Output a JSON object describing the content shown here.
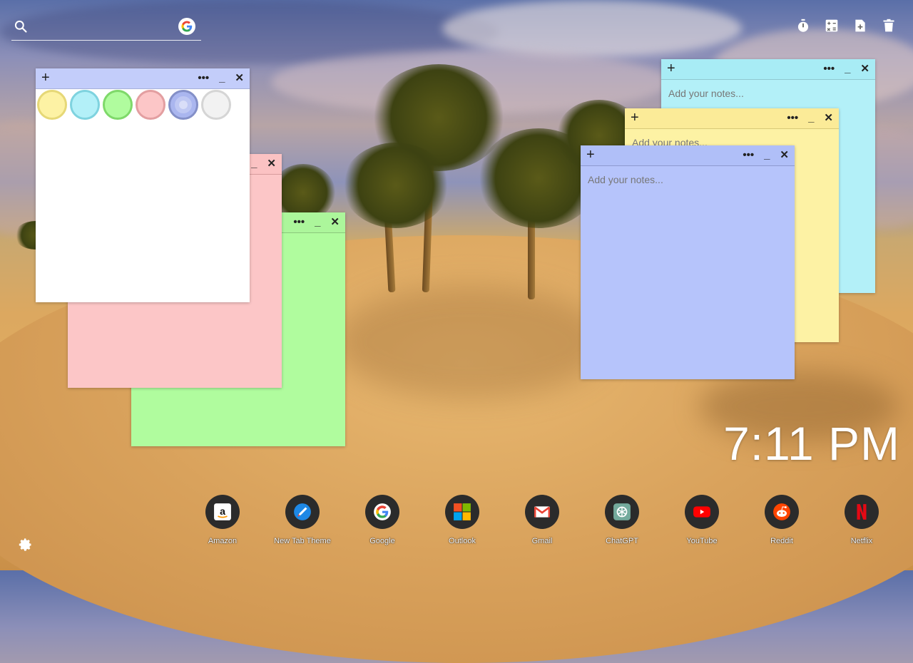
{
  "search": {
    "placeholder": "",
    "engine_icon": "google-g-icon"
  },
  "top_tools": [
    {
      "name": "timer-icon"
    },
    {
      "name": "calculator-icon"
    },
    {
      "name": "new-note-icon"
    },
    {
      "name": "trash-icon"
    }
  ],
  "notes": [
    {
      "color": "#b3f0f8",
      "placeholder": "Add your notes...",
      "plus": "+",
      "more": "•••",
      "minimize": "_",
      "close": "✕"
    },
    {
      "color": "#fdf2a4",
      "placeholder": "Add your notes...",
      "plus": "+",
      "more": "•••",
      "minimize": "_",
      "close": "✕"
    },
    {
      "color": "#b6c4fb",
      "placeholder": "Add your notes...",
      "plus": "+",
      "more": "•••",
      "minimize": "_",
      "close": "✕"
    },
    {
      "color": "#fcc6c7",
      "minimize": "_",
      "close": "✕"
    },
    {
      "color": "#b0fc9e",
      "more": "•••",
      "minimize": "_",
      "close": "✕"
    },
    {
      "color": "#ffffff",
      "plus": "+",
      "more": "•••",
      "minimize": "_",
      "close": "✕"
    }
  ],
  "color_swatches": [
    {
      "name": "yellow",
      "fill": "#fdf2a4",
      "ring": "#e6d877"
    },
    {
      "name": "cyan",
      "fill": "#b3f0f8",
      "ring": "#7fd3df"
    },
    {
      "name": "green",
      "fill": "#b0fc9e",
      "ring": "#7fd96a"
    },
    {
      "name": "pink",
      "fill": "#fcc6c7",
      "ring": "#e39fa1"
    },
    {
      "name": "periwinkle",
      "fill": "#aab6ef",
      "ring": "#8490c8",
      "selected": true
    },
    {
      "name": "white",
      "fill": "#f2f2f2",
      "ring": "#d5d5d5"
    }
  ],
  "clock": {
    "time": "7:11 PM"
  },
  "dock": [
    {
      "label": "Amazon",
      "icon": "amazon-icon"
    },
    {
      "label": "New Tab Theme",
      "icon": "new-tab-theme-icon"
    },
    {
      "label": "Google",
      "icon": "google-icon"
    },
    {
      "label": "Outlook",
      "icon": "outlook-icon"
    },
    {
      "label": "Gmail",
      "icon": "gmail-icon"
    },
    {
      "label": "ChatGPT",
      "icon": "chatgpt-icon"
    },
    {
      "label": "YouTube",
      "icon": "youtube-icon"
    },
    {
      "label": "Reddit",
      "icon": "reddit-icon"
    },
    {
      "label": "Netflix",
      "icon": "netflix-icon"
    }
  ],
  "settings_icon": "gear-icon",
  "colors": {
    "accent_white": "#ffffff",
    "dock_bg": "#2b2b2b"
  }
}
